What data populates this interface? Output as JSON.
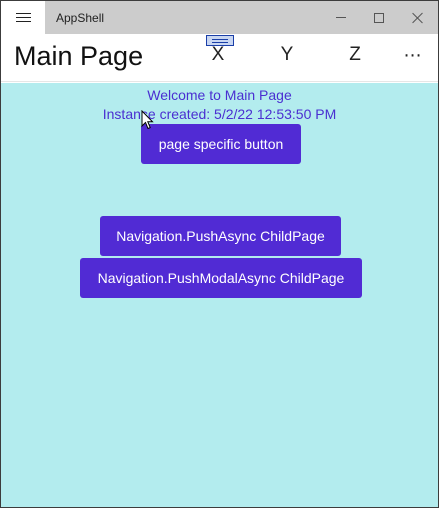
{
  "window": {
    "app_title": "AppShell"
  },
  "header": {
    "page_title": "Main Page",
    "toolbar": [
      {
        "label": "X"
      },
      {
        "label": "Y"
      },
      {
        "label": "Z"
      },
      {
        "label": "⋯"
      }
    ]
  },
  "content": {
    "welcome_text": "Welcome to Main Page",
    "instance_text": "Instance created: 5/2/22 12:53:50 PM",
    "page_button_label": "page specific button",
    "push_button_label": "Navigation.PushAsync ChildPage",
    "push_modal_button_label": "Navigation.PushModalAsync ChildPage"
  },
  "colors": {
    "content_background": "#b3ecee",
    "accent": "#512bd4",
    "text_accent": "#4a2fd1"
  }
}
